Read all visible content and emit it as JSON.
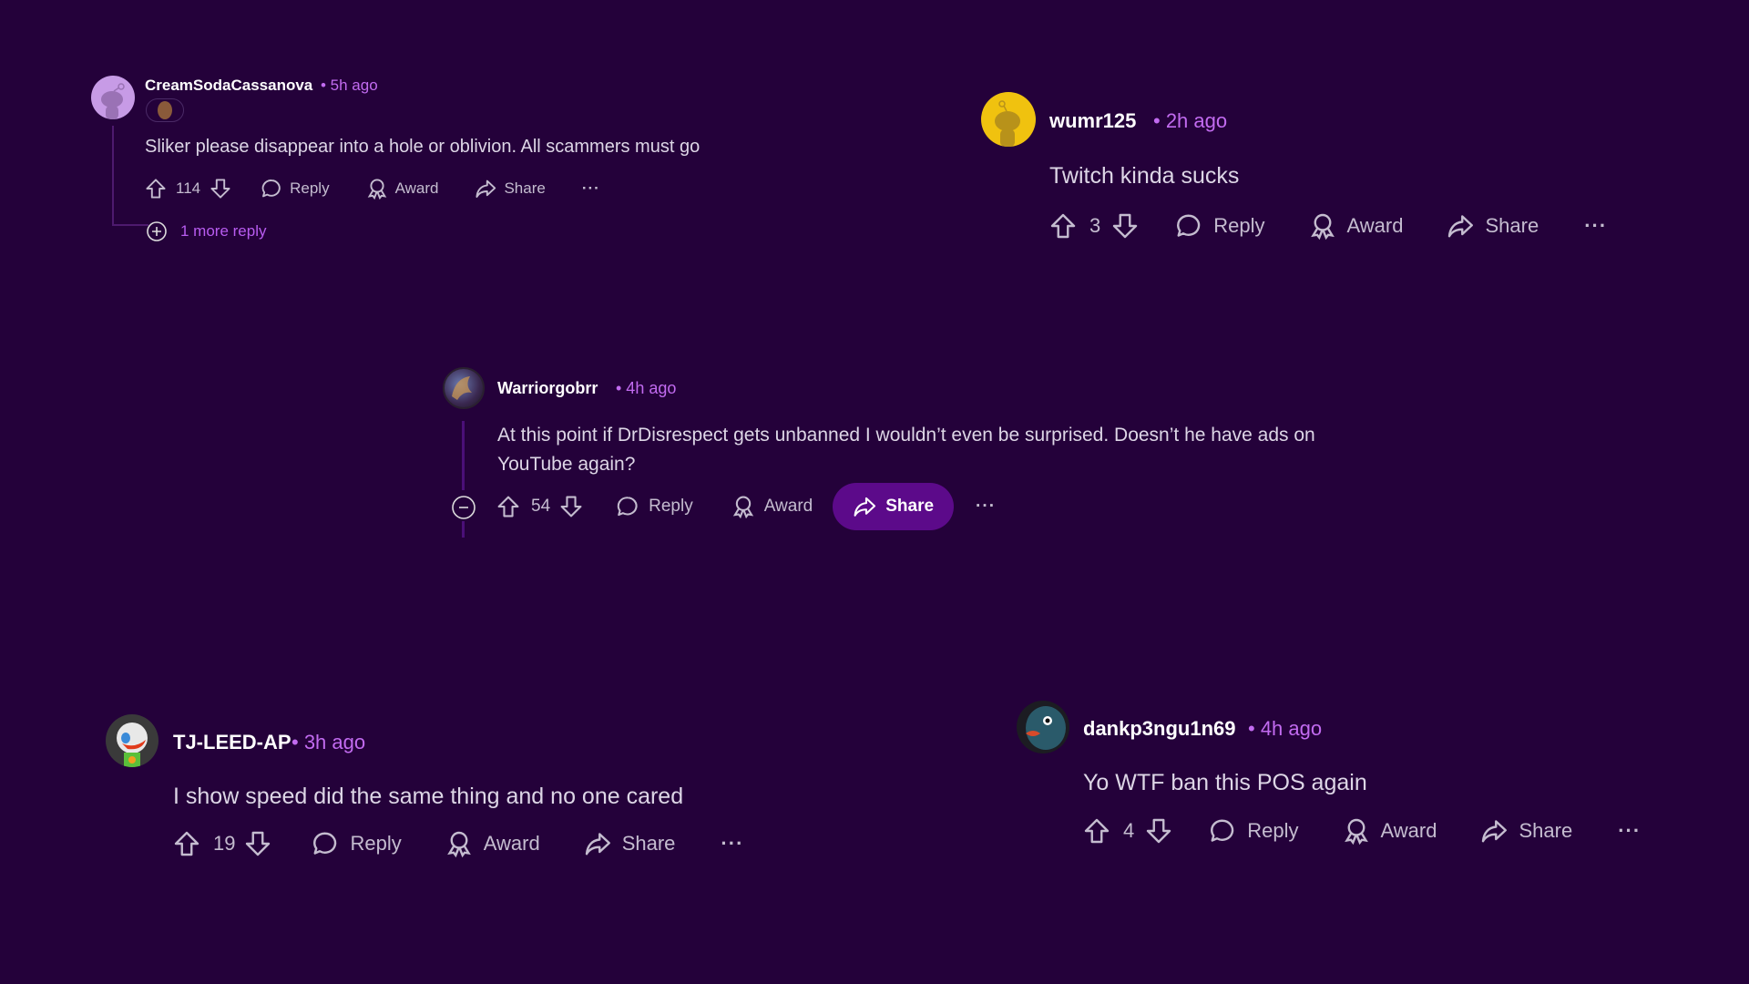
{
  "colors": {
    "background": "#24013a",
    "accent": "#c26bf0",
    "share_active": "#5c0a8a"
  },
  "comments": [
    {
      "username": "CreamSodaCassanova",
      "time": "• 5h ago",
      "text": "Sliker please disappear into a hole or oblivion. All scammers must go",
      "votes": "114",
      "reply": "Reply",
      "award": "Award",
      "share": "Share",
      "more": "···",
      "more_replies": "1 more reply",
      "avatar": "snoo-purple-avatar"
    },
    {
      "username": "wumr125",
      "time": "• 2h ago",
      "text": "Twitch kinda sucks",
      "votes": "3",
      "reply": "Reply",
      "award": "Award",
      "share": "Share",
      "more": "···",
      "avatar": "snoo-yellow-avatar"
    },
    {
      "username": "Warriorgobrr",
      "time": "• 4h ago",
      "text_line1": "At this point if DrDisrespect gets unbanned I wouldn’t even be surprised. Doesn’t he have ads on",
      "text_line2": "YouTube again?",
      "votes": "54",
      "reply": "Reply",
      "award": "Award",
      "share": "Share",
      "more": "···",
      "avatar": "warrior-avatar"
    },
    {
      "username": "TJ-LEED-AP",
      "time": "• 3h ago",
      "text": "I show speed did the same thing and no one cared",
      "votes": "19",
      "reply": "Reply",
      "award": "Award",
      "share": "Share",
      "more": "···",
      "avatar": "astronaut-duck-avatar"
    },
    {
      "username": "dankp3ngu1n69",
      "time": "• 4h ago",
      "text": "Yo WTF ban this POS again",
      "votes": "4",
      "reply": "Reply",
      "award": "Award",
      "share": "Share",
      "more": "···",
      "avatar": "penguin-avatar"
    }
  ]
}
